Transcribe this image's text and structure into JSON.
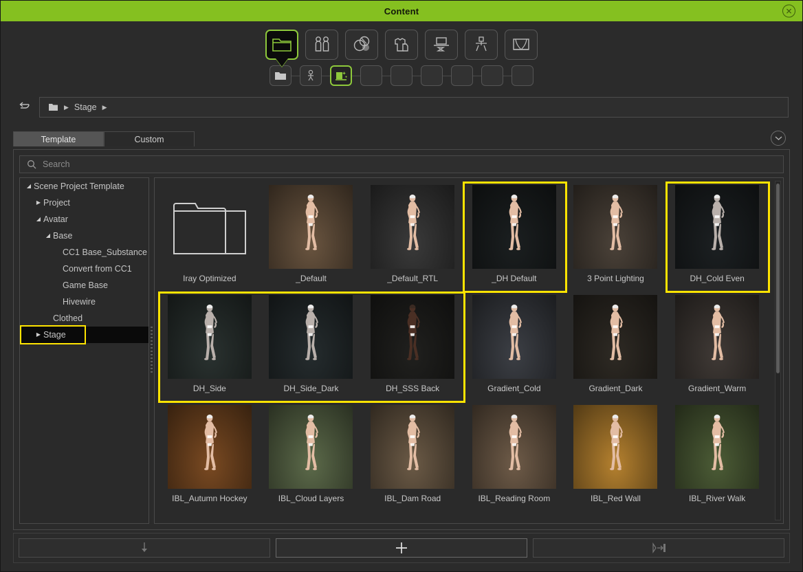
{
  "window": {
    "title": "Content",
    "close_icon": "close-circle-icon"
  },
  "toolbar_primary": [
    {
      "name": "folder",
      "icon": "folder-icon",
      "selected": true
    },
    {
      "name": "avatar",
      "icon": "two-people-icon",
      "selected": false
    },
    {
      "name": "material",
      "icon": "spheres-icon",
      "selected": false
    },
    {
      "name": "cloth",
      "icon": "shirt-icon",
      "selected": false
    },
    {
      "name": "prop",
      "icon": "prop-stand-icon",
      "selected": false
    },
    {
      "name": "motion",
      "icon": "stick-figure-icon",
      "selected": false
    },
    {
      "name": "stage",
      "icon": "stage-curtain-icon",
      "selected": false
    }
  ],
  "toolbar_secondary": [
    {
      "name": "folder-filled",
      "icon": "folder-filled-icon",
      "selected": false
    },
    {
      "name": "character",
      "icon": "person-icon",
      "selected": false
    },
    {
      "name": "scene-light",
      "icon": "stage-light-icon",
      "selected": true
    },
    {
      "name": "empty-1",
      "icon": "",
      "selected": false
    },
    {
      "name": "empty-2",
      "icon": "",
      "selected": false
    },
    {
      "name": "empty-3",
      "icon": "",
      "selected": false
    },
    {
      "name": "empty-4",
      "icon": "",
      "selected": false
    },
    {
      "name": "empty-5",
      "icon": "",
      "selected": false
    },
    {
      "name": "empty-6",
      "icon": "",
      "selected": false
    }
  ],
  "breadcrumb": {
    "back_icon": "back-arrow-icon",
    "root_icon": "folder-icon",
    "separator": "▶",
    "path": "Stage"
  },
  "tabs": {
    "items": [
      {
        "label": "Template",
        "active": true
      },
      {
        "label": "Custom",
        "active": false
      }
    ],
    "expand_icon": "chevron-down-circle-icon"
  },
  "search": {
    "icon": "search-icon",
    "placeholder": "Search",
    "value": ""
  },
  "tree": {
    "items": [
      {
        "label": "Scene Project Template",
        "depth": 0,
        "marker": "◢",
        "selected": false,
        "highlighted": false
      },
      {
        "label": "Project",
        "depth": 1,
        "marker": "▶",
        "selected": false,
        "highlighted": false
      },
      {
        "label": "Avatar",
        "depth": 1,
        "marker": "◢",
        "selected": false,
        "highlighted": false
      },
      {
        "label": "Base",
        "depth": 2,
        "marker": "◢",
        "selected": false,
        "highlighted": false
      },
      {
        "label": "CC1 Base_Substance",
        "depth": 3,
        "marker": "",
        "selected": false,
        "highlighted": false
      },
      {
        "label": "Convert from CC1",
        "depth": 3,
        "marker": "",
        "selected": false,
        "highlighted": false
      },
      {
        "label": "Game Base",
        "depth": 3,
        "marker": "",
        "selected": false,
        "highlighted": false
      },
      {
        "label": "Hivewire",
        "depth": 3,
        "marker": "",
        "selected": false,
        "highlighted": false
      },
      {
        "label": "Clothed",
        "depth": 2,
        "marker": "",
        "selected": false,
        "highlighted": false
      },
      {
        "label": "Stage",
        "depth": 1,
        "marker": "▶",
        "selected": true,
        "highlighted": true
      }
    ]
  },
  "grid": {
    "items": [
      {
        "label": "Iray Optimized",
        "type": "folder",
        "highlighted": false,
        "bg": "#2a2a2a",
        "figure": "none"
      },
      {
        "label": "_Default",
        "type": "thumbnail",
        "highlighted": false,
        "bg": "#6a5540",
        "figure": "light"
      },
      {
        "label": "_Default_RTL",
        "type": "thumbnail",
        "highlighted": false,
        "bg": "#3a3a3a",
        "figure": "light"
      },
      {
        "label": "_DH Default",
        "type": "thumbnail",
        "highlighted": true,
        "bg": "#1b1f20",
        "figure": "light"
      },
      {
        "label": "3 Point Lighting",
        "type": "thumbnail",
        "highlighted": false,
        "bg": "#4b4239",
        "figure": "light"
      },
      {
        "label": "DH_Cold Even",
        "type": "thumbnail",
        "highlighted": true,
        "bg": "#1c2022",
        "figure": "cold"
      },
      {
        "label": "DH_Side",
        "type": "thumbnail",
        "highlighted": true,
        "bg": "#2a3230",
        "figure": "cold"
      },
      {
        "label": "DH_Side_Dark",
        "type": "thumbnail",
        "highlighted": true,
        "bg": "#252c2e",
        "figure": "cold"
      },
      {
        "label": "DH_SSS Back",
        "type": "thumbnail",
        "highlighted": true,
        "bg": "#20201e",
        "figure": "dark"
      },
      {
        "label": "Gradient_Cold",
        "type": "thumbnail",
        "highlighted": false,
        "bg": "#3c3f45",
        "figure": "light"
      },
      {
        "label": "Gradient_Dark",
        "type": "thumbnail",
        "highlighted": false,
        "bg": "#2e2a24",
        "figure": "light"
      },
      {
        "label": "Gradient_Warm",
        "type": "thumbnail",
        "highlighted": false,
        "bg": "#403a36",
        "figure": "light"
      },
      {
        "label": "IBL_Autumn Hockey",
        "type": "thumbnail",
        "highlighted": false,
        "bg": "#7a4a22",
        "figure": "light"
      },
      {
        "label": "IBL_Cloud Layers",
        "type": "thumbnail",
        "highlighted": false,
        "bg": "#5c6a4a",
        "figure": "light"
      },
      {
        "label": "IBL_Dam Road",
        "type": "thumbnail",
        "highlighted": false,
        "bg": "#6b5a46",
        "figure": "light"
      },
      {
        "label": "IBL_Reading Room",
        "type": "thumbnail",
        "highlighted": false,
        "bg": "#6e5b48",
        "figure": "light"
      },
      {
        "label": "IBL_Red Wall",
        "type": "thumbnail",
        "highlighted": false,
        "bg": "#b5812f",
        "figure": "light"
      },
      {
        "label": "IBL_River Walk",
        "type": "thumbnail",
        "highlighted": false,
        "bg": "#4c5c36",
        "figure": "light"
      }
    ],
    "scrollbar": {
      "thumb_percent": 56
    }
  },
  "footer": {
    "buttons": [
      {
        "name": "download-button",
        "icon": "down-arrow-icon",
        "state": "dim"
      },
      {
        "name": "add-button",
        "icon": "plus-icon",
        "state": "bright"
      },
      {
        "name": "apply-button",
        "icon": "apply-to-icon",
        "state": "dim"
      }
    ]
  },
  "colors": {
    "accent_green": "#85c020",
    "highlight_yellow": "#ffe400",
    "panel_bg": "#2b2b2b",
    "text": "#c8c8c8"
  }
}
